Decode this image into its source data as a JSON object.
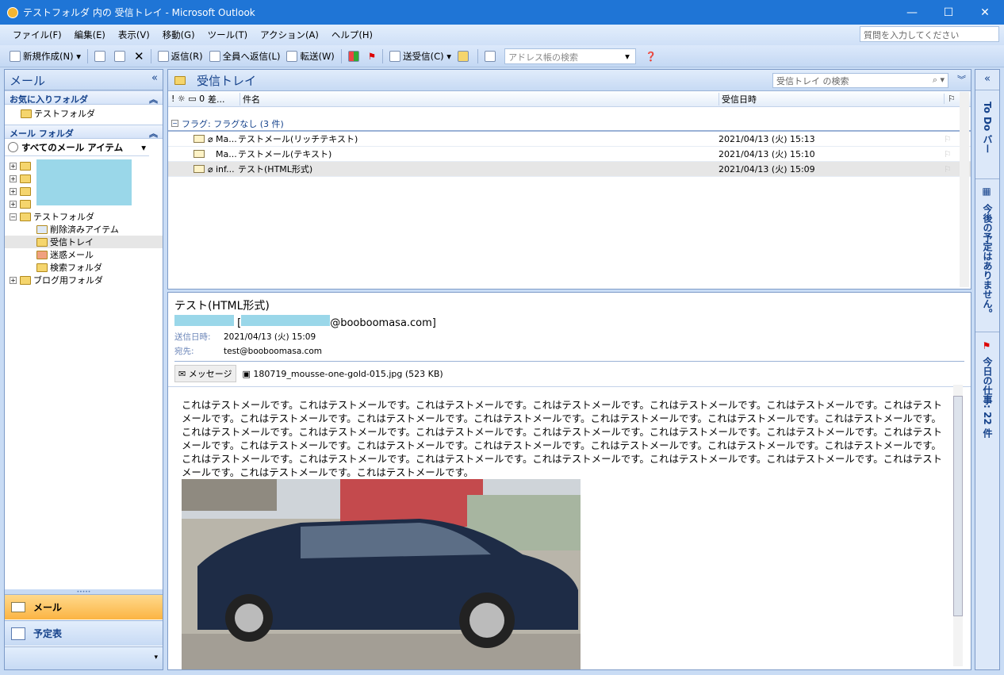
{
  "window": {
    "title": "テストフォルダ 内の 受信トレイ - Microsoft Outlook",
    "minimize": "—",
    "maximize": "☐",
    "close": "✕"
  },
  "menu": [
    "ファイル(F)",
    "編集(E)",
    "表示(V)",
    "移動(G)",
    "ツール(T)",
    "アクション(A)",
    "ヘルプ(H)"
  ],
  "help_placeholder": "質問を入力してください",
  "toolbar": {
    "new": "新規作成(N)",
    "reply": "返信(R)",
    "reply_all": "全員へ返信(L)",
    "forward": "転送(W)",
    "send_receive": "送受信(C)",
    "address_search": "アドレス帳の検索"
  },
  "nav": {
    "title": "メール",
    "collapse": "«",
    "favorites_header": "お気に入りフォルダ",
    "favorite_item": "テストフォルダ",
    "mail_folders_header": "メール フォルダ",
    "all_items": "すべてのメール アイテム",
    "folders": {
      "test": "テストフォルダ",
      "deleted": "削除済みアイテム",
      "inbox": "受信トレイ",
      "junk": "迷惑メール",
      "search": "検索フォルダ",
      "blog": "ブログ用フォルダ"
    },
    "buttons": {
      "mail": "メール",
      "calendar": "予定表"
    }
  },
  "list": {
    "title": "受信トレイ",
    "search_placeholder": "受信トレイ の検索",
    "col_subject": "件名",
    "col_from": "差...",
    "col_received": "受信日時",
    "group": "フラグ: フラグなし (3 件)",
    "rows": [
      {
        "from": "Ma...",
        "subject": "テストメール(リッチテキスト)",
        "date": "2021/04/13 (火) 15:13",
        "attach": true
      },
      {
        "from": "Ma...",
        "subject": "テストメール(テキスト)",
        "date": "2021/04/13 (火) 15:10",
        "attach": false
      },
      {
        "from": "inf...",
        "subject": "テスト(HTML形式)",
        "date": "2021/04/13 (火) 15:09",
        "attach": true
      }
    ]
  },
  "reading": {
    "subject": "テスト(HTML形式)",
    "from_domain": "@booboomasa.com]",
    "sent_label": "送信日時:",
    "sent_value": "2021/04/13 (火) 15:09",
    "to_label": "宛先:",
    "to_value": "test@booboomasa.com",
    "tab_message": "メッセージ",
    "attachment": "180719_mousse-one-gold-015.jpg (523 KB)",
    "body": "これはテストメールです。これはテストメールです。これはテストメールです。これはテストメールです。これはテストメールです。これはテストメールです。これはテストメールです。これはテストメールです。これはテストメールです。これはテストメールです。これはテストメールです。これはテストメールです。これはテストメールです。これはテストメールです。これはテストメールです。これはテストメールです。これはテストメールです。これはテストメールです。これはテストメールです。これはテストメールです。これはテストメールです。これはテストメールです。これはテストメールです。これはテストメールです。これはテストメールです。これはテストメールです。これはテストメールです。これはテストメールです。これはテストメールです。これはテストメールです。これはテストメールです。これはテストメールです。これはテストメールです。これはテストメールです。これはテストメールです。"
  },
  "todo": {
    "label": "To Do バー",
    "no_appointments": "今後の予定はありません。",
    "tasks": "今日の仕事: 22 件"
  }
}
